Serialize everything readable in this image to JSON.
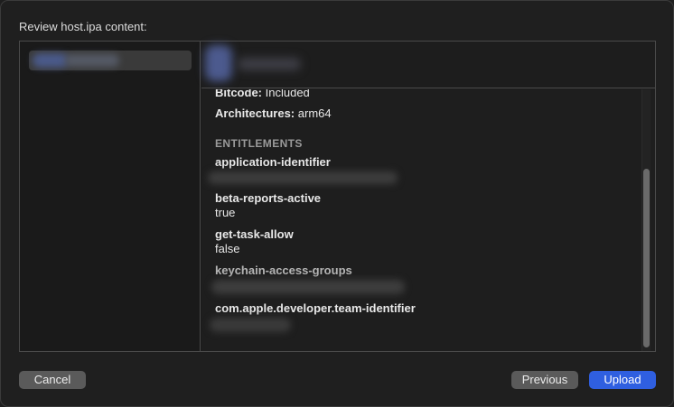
{
  "dialog": {
    "heading": "Review host.ipa content:"
  },
  "summary": {
    "bitcode_label": "Bitcode:",
    "bitcode_value": "Included",
    "architectures_label": "Architectures:",
    "architectures_value": "arm64"
  },
  "entitlements": {
    "section_title": "ENTITLEMENTS",
    "items": [
      {
        "key": "application-identifier",
        "value": ""
      },
      {
        "key": "beta-reports-active",
        "value": "true"
      },
      {
        "key": "get-task-allow",
        "value": "false"
      },
      {
        "key": "keychain-access-groups",
        "value": ""
      },
      {
        "key": "com.apple.developer.team-identifier",
        "value": ""
      }
    ]
  },
  "buttons": {
    "cancel": "Cancel",
    "previous": "Previous",
    "upload": "Upload"
  },
  "colors": {
    "accent": "#2f5fe0",
    "button": "#5a5a5a",
    "background": "#1f1f1f"
  }
}
